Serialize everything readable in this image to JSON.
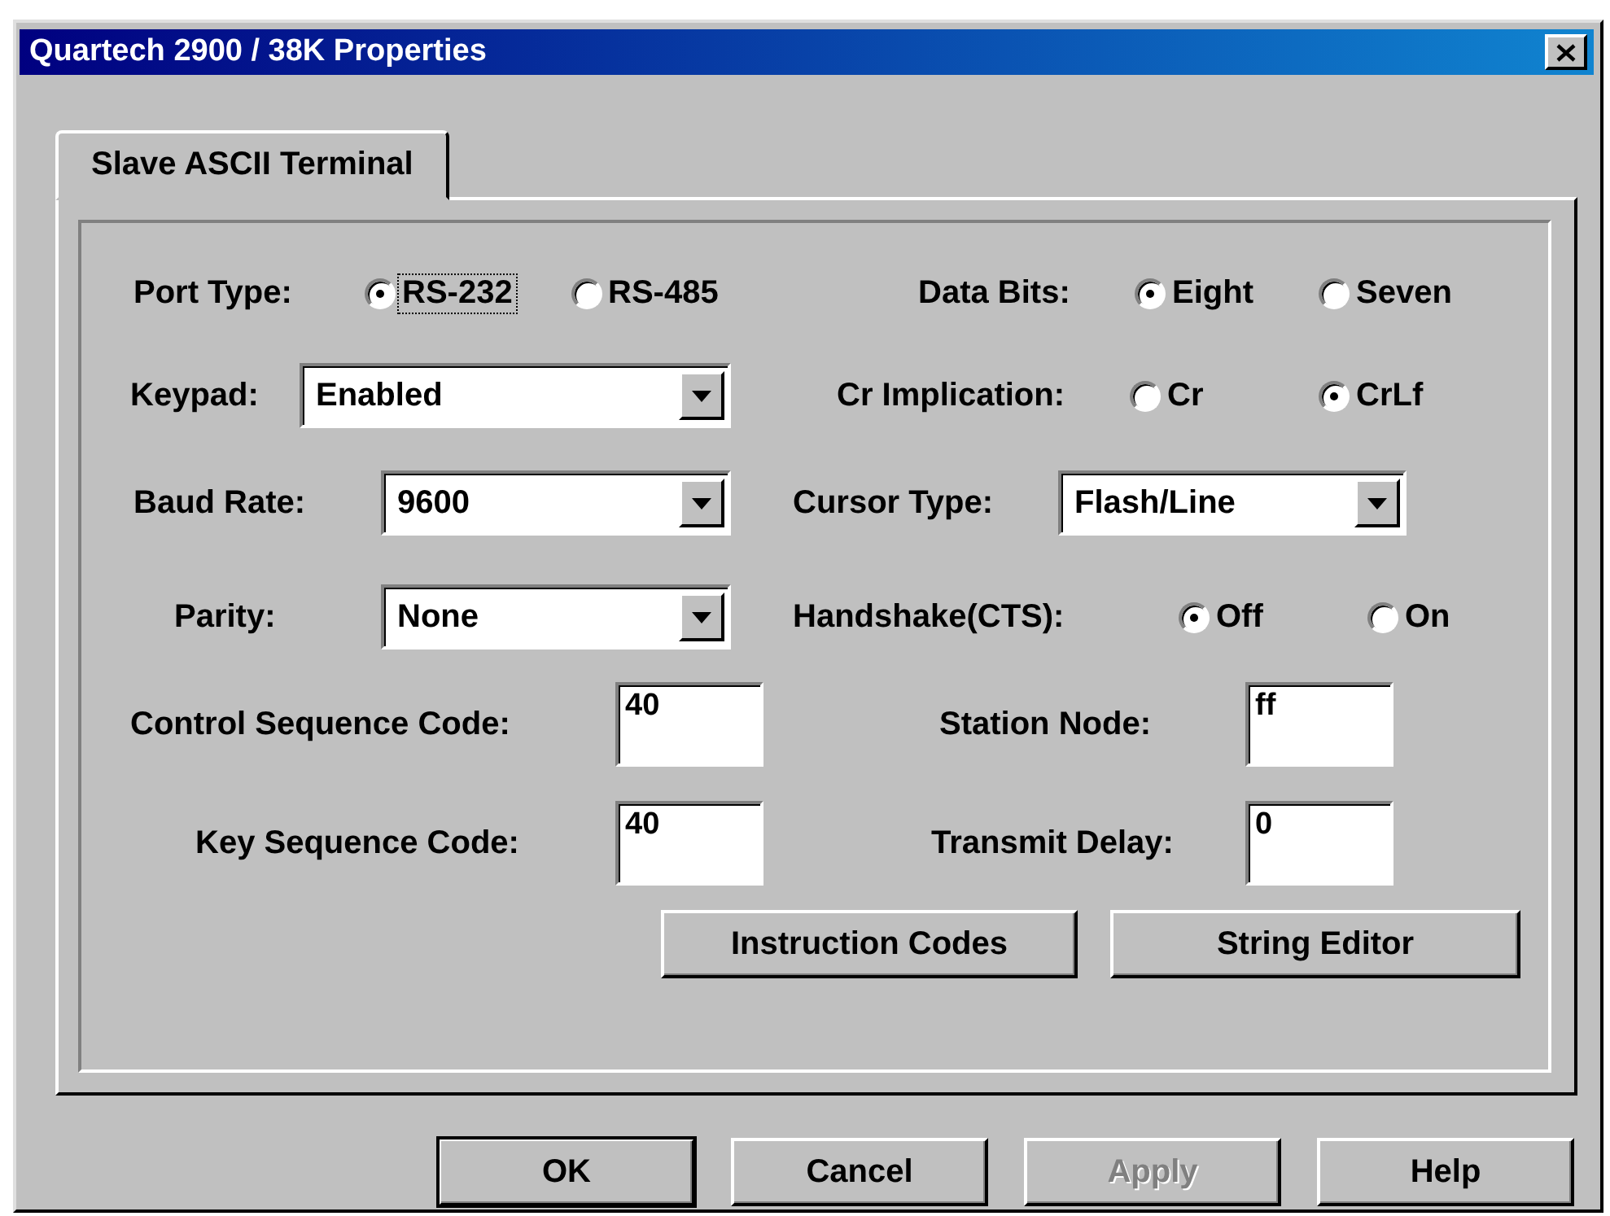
{
  "window": {
    "title": "Quartech 2900 / 38K Properties"
  },
  "tabs": [
    {
      "label": "Slave ASCII Terminal",
      "selected": true
    }
  ],
  "left_column": [
    {
      "kind": "radio",
      "label": "Port Type:",
      "options": [
        {
          "label": "RS-232",
          "selected": true,
          "focused": true
        },
        {
          "label": "RS-485",
          "selected": false,
          "focused": false
        }
      ]
    },
    {
      "kind": "combo",
      "label": "Keypad:",
      "value": "Enabled"
    },
    {
      "kind": "combo",
      "label": "Baud Rate:",
      "value": "9600"
    },
    {
      "kind": "combo",
      "label": "Parity:",
      "value": "None"
    },
    {
      "kind": "text",
      "label": "Control Sequence Code:",
      "value": "40"
    },
    {
      "kind": "text",
      "label": "Key Sequence Code:",
      "value": "40"
    }
  ],
  "right_column": [
    {
      "kind": "radio",
      "label": "Data Bits:",
      "options": [
        {
          "label": "Eight",
          "selected": true,
          "focused": false
        },
        {
          "label": "Seven",
          "selected": false,
          "focused": false
        }
      ]
    },
    {
      "kind": "radio",
      "label": "Cr Implication:",
      "options": [
        {
          "label": "Cr",
          "selected": false,
          "focused": false
        },
        {
          "label": "CrLf",
          "selected": true,
          "focused": false
        }
      ]
    },
    {
      "kind": "combo",
      "label": "Cursor Type:",
      "value": "Flash/Line"
    },
    {
      "kind": "radio",
      "label": "Handshake(CTS):",
      "options": [
        {
          "label": "Off",
          "selected": true,
          "focused": false
        },
        {
          "label": "On",
          "selected": false,
          "focused": false
        }
      ]
    },
    {
      "kind": "text",
      "label": "Station Node:",
      "value": "ff"
    },
    {
      "kind": "text",
      "label": "Transmit Delay:",
      "value": "0"
    }
  ],
  "panel_buttons": [
    "Instruction Codes",
    "String Editor"
  ],
  "dialog_buttons": [
    {
      "label": "OK",
      "default": true,
      "disabled": false
    },
    {
      "label": "Cancel",
      "default": false,
      "disabled": false
    },
    {
      "label": "Apply",
      "default": false,
      "disabled": true
    },
    {
      "label": "Help",
      "default": false,
      "disabled": false
    }
  ]
}
